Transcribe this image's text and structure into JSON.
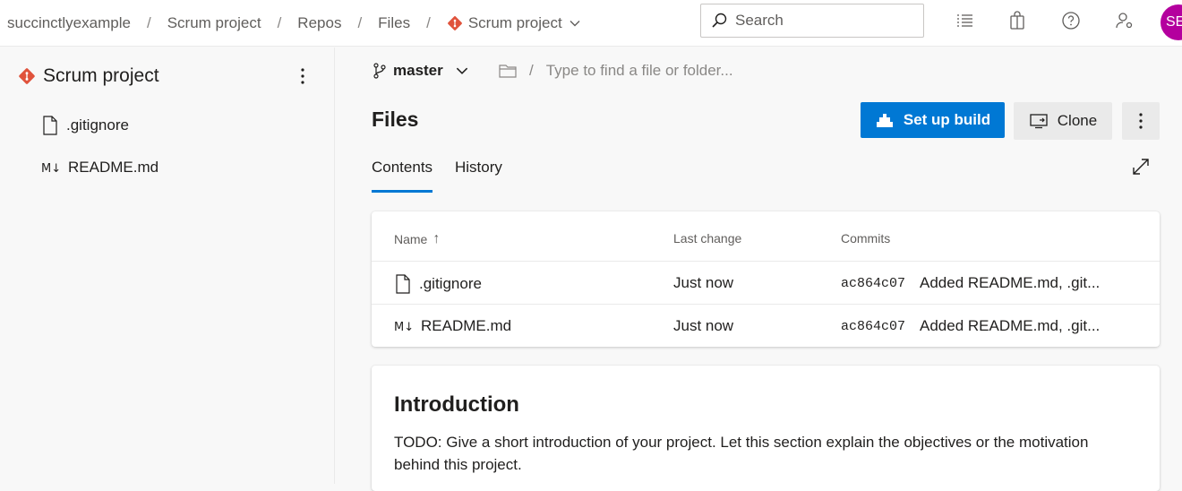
{
  "breadcrumb": {
    "org": "succinctlyexample",
    "project": "Scrum project",
    "repos": "Repos",
    "files": "Files",
    "repo": "Scrum project",
    "separator": "/"
  },
  "search": {
    "placeholder": "Search"
  },
  "user": {
    "initials": "SE",
    "avatar_color": "#b4009e"
  },
  "sidebar": {
    "repo_name": "Scrum project",
    "items": [
      {
        "label": ".gitignore",
        "icon": "file-icon"
      },
      {
        "label": "README.md",
        "icon": "markdown-icon"
      }
    ]
  },
  "main": {
    "branch": "master",
    "path_separator": "/",
    "path_placeholder": "Type to find a file or folder...",
    "title": "Files",
    "setup_build_label": "Set up build",
    "clone_label": "Clone",
    "tabs": [
      {
        "label": "Contents",
        "active": true
      },
      {
        "label": "History",
        "active": false
      }
    ],
    "table": {
      "headers": {
        "name": "Name",
        "last_change": "Last change",
        "commits": "Commits"
      },
      "sort_indicator": "↑",
      "rows": [
        {
          "name": ".gitignore",
          "icon": "file-icon",
          "last_change": "Just now",
          "commit_hash": "ac864c07",
          "commit_msg": "Added README.md, .git..."
        },
        {
          "name": "README.md",
          "icon": "markdown-icon",
          "last_change": "Just now",
          "commit_hash": "ac864c07",
          "commit_msg": "Added README.md, .git..."
        }
      ]
    },
    "readme": {
      "heading": "Introduction",
      "body": "TODO: Give a short introduction of your project. Let this section explain the objectives or the motivation behind this project."
    }
  },
  "colors": {
    "accent": "#0078d4",
    "git_brand": "#e0533c"
  }
}
